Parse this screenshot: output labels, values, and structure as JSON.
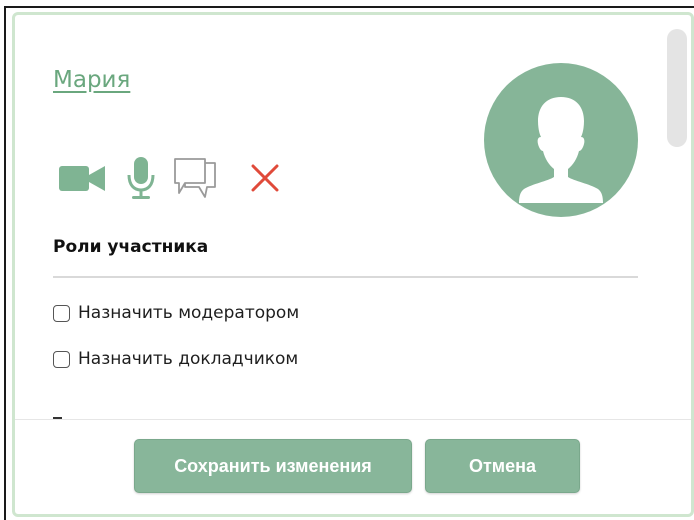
{
  "participant": {
    "name": "Мария"
  },
  "roles": {
    "title": "Роли участника",
    "items": [
      {
        "label": "Назначить модератором",
        "checked": false
      },
      {
        "label": "Назначить докладчиком",
        "checked": false
      }
    ]
  },
  "controls": {
    "icons": [
      "video-camera-icon",
      "microphone-icon",
      "chat-icon",
      "remove-icon"
    ]
  },
  "footer": {
    "save_label": "Сохранить изменения",
    "cancel_label": "Отмена"
  },
  "colors": {
    "accent": "#86b598",
    "button": "#88b69a",
    "link": "#6aa77e",
    "danger": "#e04a3a",
    "dialog_border": "#cfe6cf"
  }
}
